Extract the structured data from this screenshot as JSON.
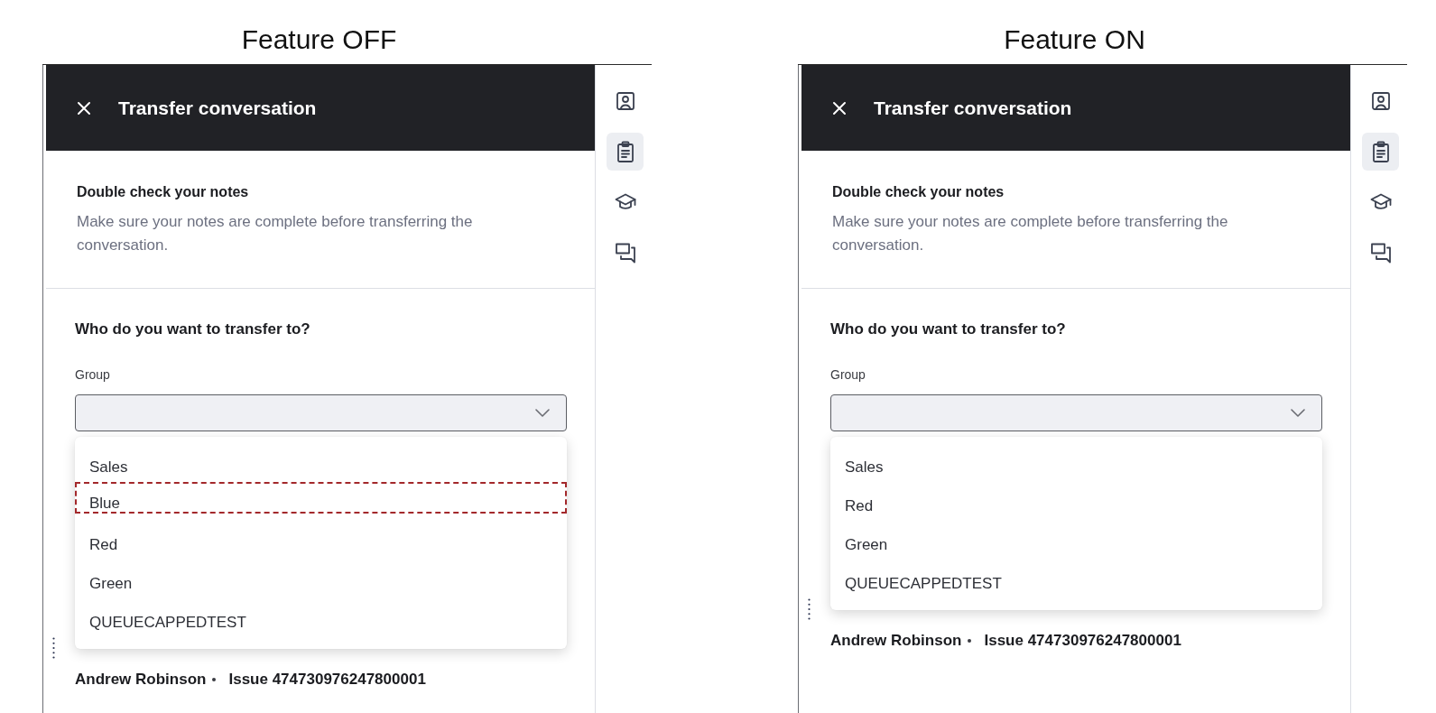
{
  "panels": [
    {
      "caption": "Feature OFF",
      "header": {
        "title": "Transfer conversation"
      },
      "notes": {
        "heading": "Double check your notes",
        "text": "Make sure your notes are complete before transferring the conversation."
      },
      "transfer": {
        "question": "Who do you want to transfer to?",
        "group": {
          "label": "Group",
          "expanded": true,
          "options": [
            {
              "label": "Sales",
              "highlighted": false
            },
            {
              "label": "Blue",
              "highlighted": true
            },
            {
              "label": "Red",
              "highlighted": false
            },
            {
              "label": "Green",
              "highlighted": false
            },
            {
              "label": "QUEUECAPPEDTEST",
              "highlighted": false
            }
          ]
        }
      },
      "footer": {
        "name": "Andrew Robinson",
        "issue": "Issue 474730976247800001"
      },
      "rail": [
        {
          "selected": false
        },
        {
          "selected": true
        },
        {
          "selected": false
        },
        {
          "selected": false
        }
      ]
    },
    {
      "caption": "Feature ON",
      "header": {
        "title": "Transfer conversation"
      },
      "notes": {
        "heading": "Double check your notes",
        "text": "Make sure your notes are complete before transferring the conversation."
      },
      "transfer": {
        "question": "Who do you want to transfer to?",
        "group": {
          "label": "Group",
          "expanded": true,
          "options": [
            {
              "label": "Sales",
              "highlighted": false
            },
            {
              "label": "Red",
              "highlighted": false
            },
            {
              "label": "Green",
              "highlighted": false
            },
            {
              "label": "QUEUECAPPEDTEST",
              "highlighted": false
            }
          ]
        }
      },
      "footer": {
        "name": "Andrew Robinson",
        "issue": "Issue 474730976247800001"
      },
      "rail": [
        {
          "selected": false
        },
        {
          "selected": true
        },
        {
          "selected": false
        },
        {
          "selected": false
        }
      ]
    }
  ]
}
